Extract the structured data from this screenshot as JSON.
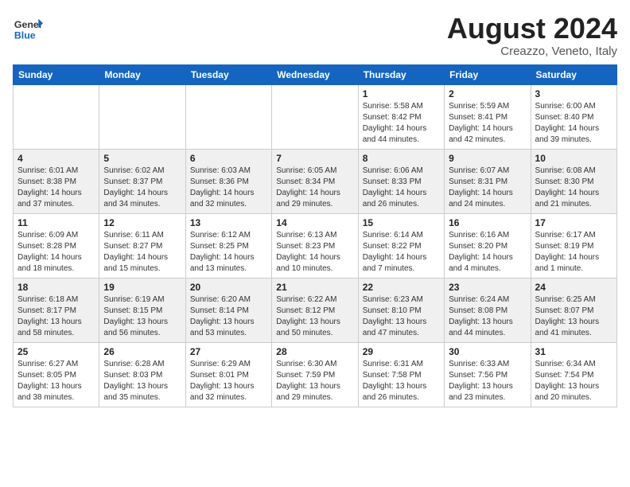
{
  "header": {
    "logo_general": "General",
    "logo_blue": "Blue",
    "month_title": "August 2024",
    "subtitle": "Creazzo, Veneto, Italy"
  },
  "weekdays": [
    "Sunday",
    "Monday",
    "Tuesday",
    "Wednesday",
    "Thursday",
    "Friday",
    "Saturday"
  ],
  "weeks": [
    [
      {
        "day": "",
        "info": ""
      },
      {
        "day": "",
        "info": ""
      },
      {
        "day": "",
        "info": ""
      },
      {
        "day": "",
        "info": ""
      },
      {
        "day": "1",
        "info": "Sunrise: 5:58 AM\nSunset: 8:42 PM\nDaylight: 14 hours\nand 44 minutes."
      },
      {
        "day": "2",
        "info": "Sunrise: 5:59 AM\nSunset: 8:41 PM\nDaylight: 14 hours\nand 42 minutes."
      },
      {
        "day": "3",
        "info": "Sunrise: 6:00 AM\nSunset: 8:40 PM\nDaylight: 14 hours\nand 39 minutes."
      }
    ],
    [
      {
        "day": "4",
        "info": "Sunrise: 6:01 AM\nSunset: 8:38 PM\nDaylight: 14 hours\nand 37 minutes."
      },
      {
        "day": "5",
        "info": "Sunrise: 6:02 AM\nSunset: 8:37 PM\nDaylight: 14 hours\nand 34 minutes."
      },
      {
        "day": "6",
        "info": "Sunrise: 6:03 AM\nSunset: 8:36 PM\nDaylight: 14 hours\nand 32 minutes."
      },
      {
        "day": "7",
        "info": "Sunrise: 6:05 AM\nSunset: 8:34 PM\nDaylight: 14 hours\nand 29 minutes."
      },
      {
        "day": "8",
        "info": "Sunrise: 6:06 AM\nSunset: 8:33 PM\nDaylight: 14 hours\nand 26 minutes."
      },
      {
        "day": "9",
        "info": "Sunrise: 6:07 AM\nSunset: 8:31 PM\nDaylight: 14 hours\nand 24 minutes."
      },
      {
        "day": "10",
        "info": "Sunrise: 6:08 AM\nSunset: 8:30 PM\nDaylight: 14 hours\nand 21 minutes."
      }
    ],
    [
      {
        "day": "11",
        "info": "Sunrise: 6:09 AM\nSunset: 8:28 PM\nDaylight: 14 hours\nand 18 minutes."
      },
      {
        "day": "12",
        "info": "Sunrise: 6:11 AM\nSunset: 8:27 PM\nDaylight: 14 hours\nand 15 minutes."
      },
      {
        "day": "13",
        "info": "Sunrise: 6:12 AM\nSunset: 8:25 PM\nDaylight: 14 hours\nand 13 minutes."
      },
      {
        "day": "14",
        "info": "Sunrise: 6:13 AM\nSunset: 8:23 PM\nDaylight: 14 hours\nand 10 minutes."
      },
      {
        "day": "15",
        "info": "Sunrise: 6:14 AM\nSunset: 8:22 PM\nDaylight: 14 hours\nand 7 minutes."
      },
      {
        "day": "16",
        "info": "Sunrise: 6:16 AM\nSunset: 8:20 PM\nDaylight: 14 hours\nand 4 minutes."
      },
      {
        "day": "17",
        "info": "Sunrise: 6:17 AM\nSunset: 8:19 PM\nDaylight: 14 hours\nand 1 minute."
      }
    ],
    [
      {
        "day": "18",
        "info": "Sunrise: 6:18 AM\nSunset: 8:17 PM\nDaylight: 13 hours\nand 58 minutes."
      },
      {
        "day": "19",
        "info": "Sunrise: 6:19 AM\nSunset: 8:15 PM\nDaylight: 13 hours\nand 56 minutes."
      },
      {
        "day": "20",
        "info": "Sunrise: 6:20 AM\nSunset: 8:14 PM\nDaylight: 13 hours\nand 53 minutes."
      },
      {
        "day": "21",
        "info": "Sunrise: 6:22 AM\nSunset: 8:12 PM\nDaylight: 13 hours\nand 50 minutes."
      },
      {
        "day": "22",
        "info": "Sunrise: 6:23 AM\nSunset: 8:10 PM\nDaylight: 13 hours\nand 47 minutes."
      },
      {
        "day": "23",
        "info": "Sunrise: 6:24 AM\nSunset: 8:08 PM\nDaylight: 13 hours\nand 44 minutes."
      },
      {
        "day": "24",
        "info": "Sunrise: 6:25 AM\nSunset: 8:07 PM\nDaylight: 13 hours\nand 41 minutes."
      }
    ],
    [
      {
        "day": "25",
        "info": "Sunrise: 6:27 AM\nSunset: 8:05 PM\nDaylight: 13 hours\nand 38 minutes."
      },
      {
        "day": "26",
        "info": "Sunrise: 6:28 AM\nSunset: 8:03 PM\nDaylight: 13 hours\nand 35 minutes."
      },
      {
        "day": "27",
        "info": "Sunrise: 6:29 AM\nSunset: 8:01 PM\nDaylight: 13 hours\nand 32 minutes."
      },
      {
        "day": "28",
        "info": "Sunrise: 6:30 AM\nSunset: 7:59 PM\nDaylight: 13 hours\nand 29 minutes."
      },
      {
        "day": "29",
        "info": "Sunrise: 6:31 AM\nSunset: 7:58 PM\nDaylight: 13 hours\nand 26 minutes."
      },
      {
        "day": "30",
        "info": "Sunrise: 6:33 AM\nSunset: 7:56 PM\nDaylight: 13 hours\nand 23 minutes."
      },
      {
        "day": "31",
        "info": "Sunrise: 6:34 AM\nSunset: 7:54 PM\nDaylight: 13 hours\nand 20 minutes."
      }
    ]
  ]
}
